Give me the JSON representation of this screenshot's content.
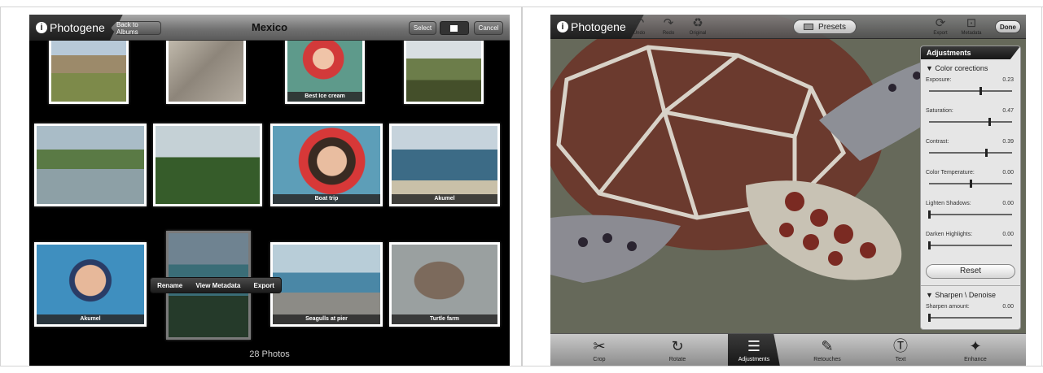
{
  "left": {
    "brand": "Photogene",
    "back_label": "Back to Albums",
    "album_title": "Mexico",
    "select_label": "Select",
    "cancel_label": "Cancel",
    "thumbnails": [
      {
        "caption": ""
      },
      {
        "caption": ""
      },
      {
        "caption": "Best Ice cream"
      },
      {
        "caption": ""
      },
      {
        "caption": ""
      },
      {
        "caption": ""
      },
      {
        "caption": "Boat trip"
      },
      {
        "caption": "Akumel"
      },
      {
        "caption": "Akumel"
      },
      {
        "caption": ""
      },
      {
        "caption": "Seagulls at pier"
      },
      {
        "caption": "Turtle farm"
      }
    ],
    "context_menu": [
      "Rename",
      "View Metadata",
      "Export"
    ],
    "photo_count": "28 Photos"
  },
  "right": {
    "brand": "Photogene",
    "tools": {
      "undo": "Undo",
      "redo": "Redo",
      "original": "Original"
    },
    "presets_label": "Presets",
    "export_label": "Export",
    "metadata_label": "Metadata",
    "done_label": "Done",
    "panel": {
      "title": "Adjustments",
      "section1": "▼ Color corections",
      "sliders": [
        {
          "label": "Exposure:",
          "value": "0.23",
          "level": 0.62
        },
        {
          "label": "Saturation:",
          "value": "0.47",
          "level": 0.73
        },
        {
          "label": "Contrast:",
          "value": "0.39",
          "level": 0.69
        },
        {
          "label": "Color Temperature:",
          "value": "0.00",
          "level": 0.5
        },
        {
          "label": "Lighten Shadows:",
          "value": "0.00",
          "level": 0.0
        },
        {
          "label": "Darken Highlights:",
          "value": "0.00",
          "level": 0.0
        }
      ],
      "reset_label": "Reset",
      "section2": "▼ Sharpen \\ Denoise",
      "sharpen": {
        "label": "Sharpen amount:",
        "value": "0.00",
        "level": 0.0
      }
    },
    "bottom_tabs": [
      {
        "label": "Crop",
        "icon": "scissors-icon",
        "glyph": "✂"
      },
      {
        "label": "Rotate",
        "icon": "rotate-icon",
        "glyph": "↻"
      },
      {
        "label": "Adjustments",
        "icon": "adjustments-icon",
        "glyph": "☰"
      },
      {
        "label": "Retouches",
        "icon": "retouch-icon",
        "glyph": "✎"
      },
      {
        "label": "Text",
        "icon": "text-icon",
        "glyph": "Ⓣ"
      },
      {
        "label": "Enhance",
        "icon": "enhance-icon",
        "glyph": "✦"
      }
    ]
  }
}
